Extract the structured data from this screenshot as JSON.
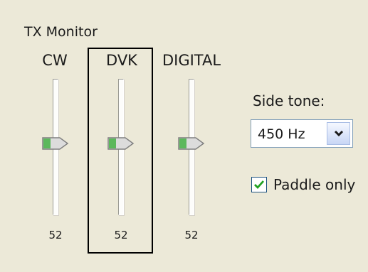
{
  "group": {
    "title": "TX Monitor"
  },
  "sliders": [
    {
      "label": "CW",
      "value": "52"
    },
    {
      "label": "DVK",
      "value": "52"
    },
    {
      "label": "DIGITAL",
      "value": "52"
    }
  ],
  "side_tone": {
    "label": "Side tone:",
    "selected": "450 Hz"
  },
  "paddle_only": {
    "label": "Paddle only",
    "checked": true
  },
  "colors": {
    "panel_bg": "#ece9d8",
    "thumb_green": "#5cb85c",
    "focus_border": "#000000",
    "combo_border": "#7f9db9",
    "checkbox_border": "#1c5180",
    "check_green": "#21a121"
  },
  "icons": {
    "dropdown": "chevron-down-icon",
    "check": "checkmark-icon",
    "thumb": "slider-thumb-icon"
  }
}
